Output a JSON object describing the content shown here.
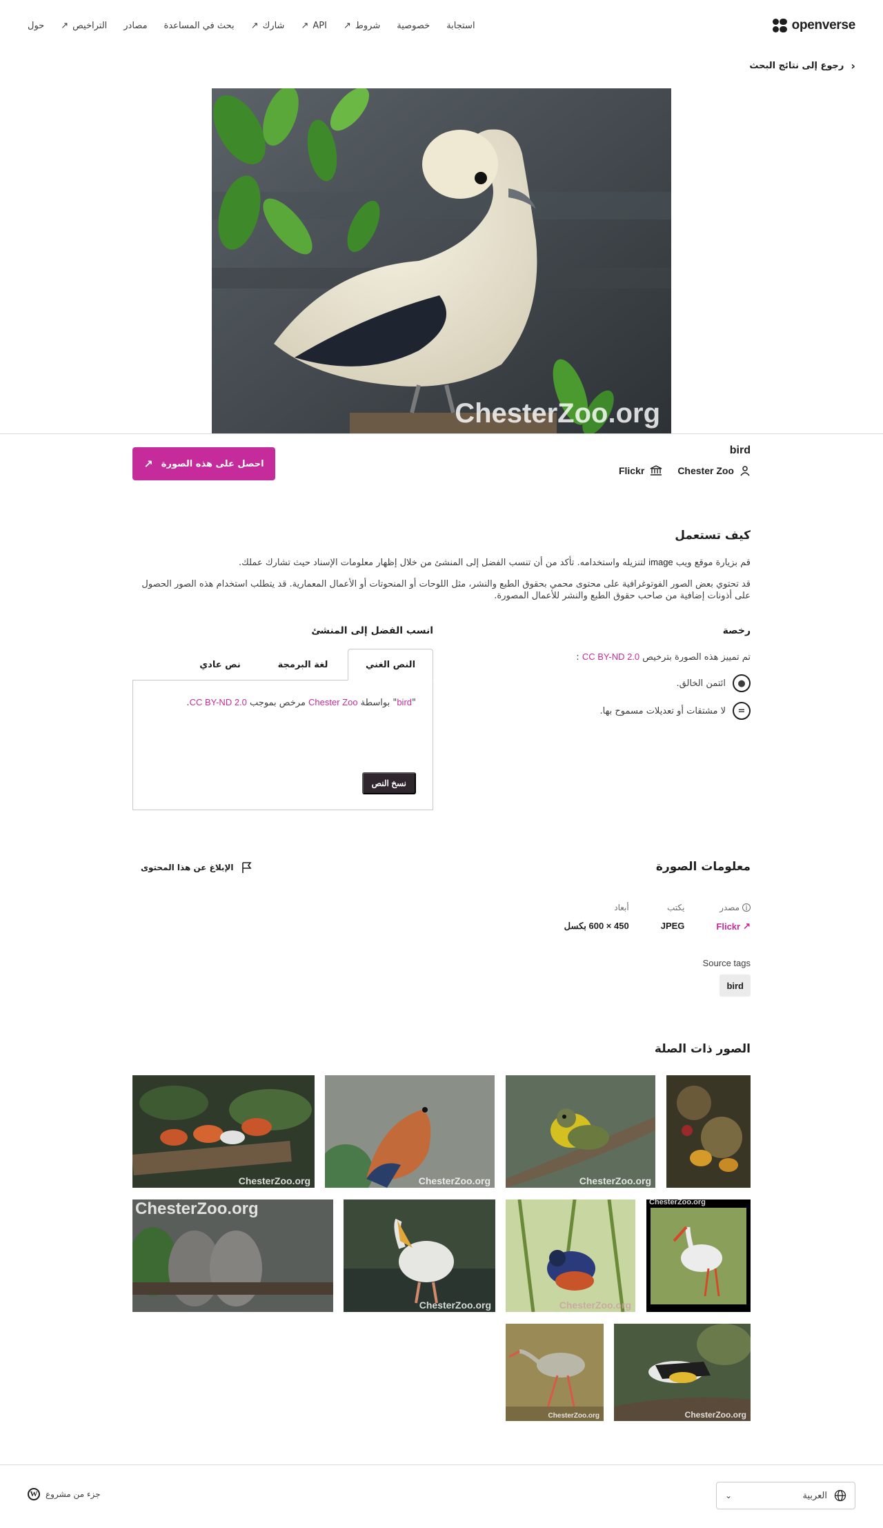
{
  "header": {
    "logo_text": "openverse",
    "nav": [
      {
        "label": "حول",
        "external": false
      },
      {
        "label": "التراخيص",
        "external": true
      },
      {
        "label": "مصادر",
        "external": false
      },
      {
        "label": "بحث في المساعدة",
        "external": false
      },
      {
        "label": "شارك",
        "external": true
      },
      {
        "label": "API",
        "external": true
      },
      {
        "label": "شروط",
        "external": true
      },
      {
        "label": "خصوصية",
        "external": false
      },
      {
        "label": "استجابة",
        "external": false
      }
    ]
  },
  "back_link": "رجوع إلى نتائج البحث",
  "image": {
    "title": "bird",
    "creator": "Chester Zoo",
    "provider": "Flickr",
    "watermark": "ChesterZoo.org",
    "get_button": "احصل على هذه الصورة"
  },
  "how_to_use": {
    "title": "كيف تستعمل",
    "p1_before": "قم بزيارة موقع ويب ",
    "p1_link": "image",
    "p1_after": " لتنزيله واستخدامه. تأكد من أن تنسب الفضل إلى المنشئ من خلال إظهار معلومات الإسناد حيث تشارك عملك.",
    "p2": "قد تحتوي بعض الصور الفوتوغرافية على محتوى محمي بحقوق الطبع والنشر، مثل اللوحات أو المنحوتات أو الأعمال المعمارية. قد يتطلب استخدام هذه الصور الحصول على أذونات إضافية من صاحب حقوق الطبع والنشر للأعمال المصورة."
  },
  "license": {
    "title": "رخصة",
    "intro": "تم تمييز هذه الصورة بترخيص",
    "name": "CC BY-ND 2.0",
    "colon": ":",
    "by": "ائتمن الخالق.",
    "nd": "لا مشتقات أو تعديلات مسموح بها."
  },
  "attribution": {
    "title": "انسب الفضل إلى المنشئ",
    "tabs": [
      "النص الغني",
      "لغة البرمجة",
      "نص عادي"
    ],
    "text_quote_open": "\"",
    "text_title": "bird",
    "text_quote_close": "\"",
    "text_by": " بواسطة ",
    "text_creator": "Chester Zoo",
    "text_licensed": " مرخص بموجب ",
    "text_license": "CC BY-ND 2.0",
    "text_end": ".",
    "copy_button": "نسخ النص"
  },
  "image_info": {
    "title": "معلومات الصورة",
    "report": "الإبلاغ عن هذا المحتوى",
    "source_label": "مصدر",
    "source_value": "Flickr",
    "type_label": "يكتب",
    "type_value": "JPEG",
    "dims_label": "أبعاد",
    "dims_value": "450 × 600 بكسل",
    "source_tags_label": "Source tags",
    "tags": [
      "bird"
    ]
  },
  "related": {
    "title": "الصور ذات الصلة",
    "watermark": "ChesterZoo.org"
  },
  "footer": {
    "part_of": "جزء من مشروع",
    "language": "العربية"
  },
  "colors": {
    "accent": "#c52b9b",
    "dark_button": "#30272e"
  }
}
